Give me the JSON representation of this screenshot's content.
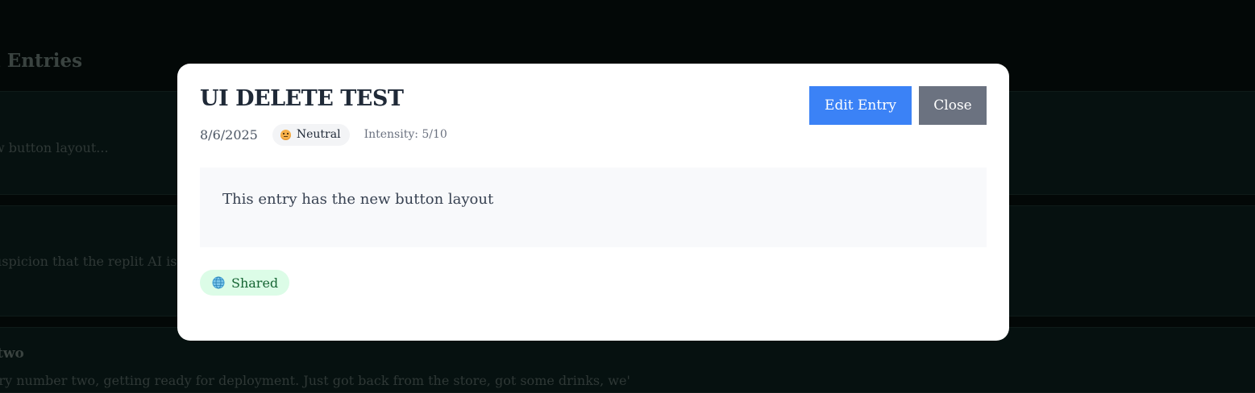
{
  "background": {
    "heading": "l Entries",
    "entries": [
      {
        "title": "",
        "snippet": "w button layout..."
      },
      {
        "title": "",
        "snippet": "uspicion that the replit AI is c"
      },
      {
        "title": "two",
        "snippet": "try number two, getting ready for deployment. Just got back from the store, got some drinks, we'"
      }
    ]
  },
  "modal": {
    "title": "UI DELETE TEST",
    "date": "8/6/2025",
    "mood": {
      "label": "Neutral",
      "icon": "grimacing-face-icon"
    },
    "intensity": "Intensity: 5/10",
    "content": "This entry has the new button layout",
    "shared": {
      "label": "Shared",
      "icon": "globe-icon"
    },
    "buttons": {
      "edit_label": "Edit Entry",
      "close_label": "Close"
    }
  },
  "colors": {
    "primary": "#3b82f6",
    "secondary": "#6b7280",
    "shared_bg": "#dcfce7",
    "shared_text": "#166534",
    "overlay": "#030807"
  }
}
